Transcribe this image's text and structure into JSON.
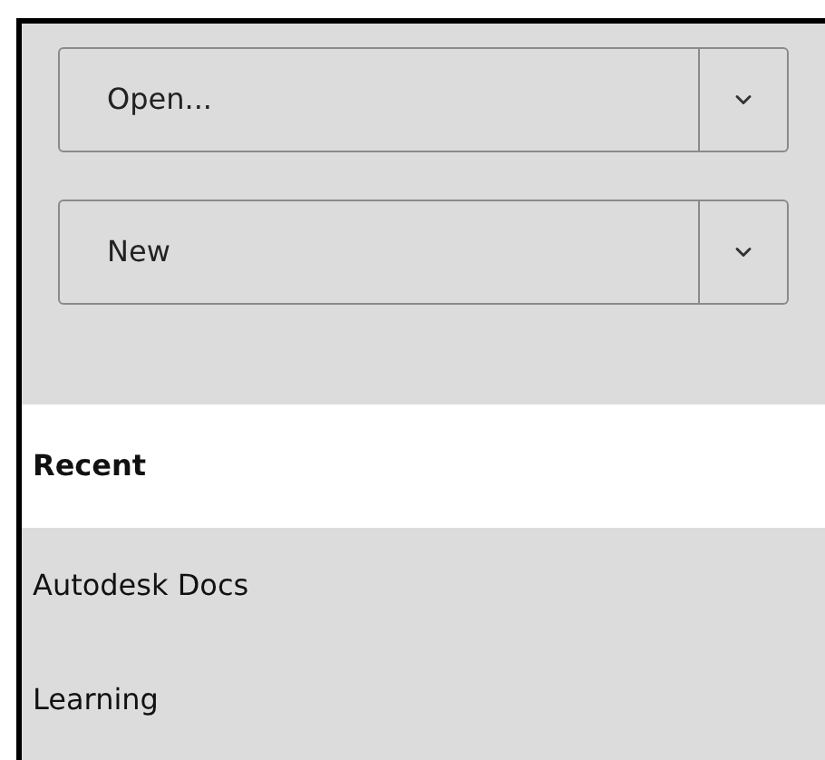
{
  "actions": [
    {
      "label": "Open..."
    },
    {
      "label": "New"
    }
  ],
  "nav": [
    {
      "label": "Recent",
      "selected": true
    },
    {
      "label": "Autodesk Docs",
      "selected": false
    },
    {
      "label": "Learning",
      "selected": false
    }
  ]
}
